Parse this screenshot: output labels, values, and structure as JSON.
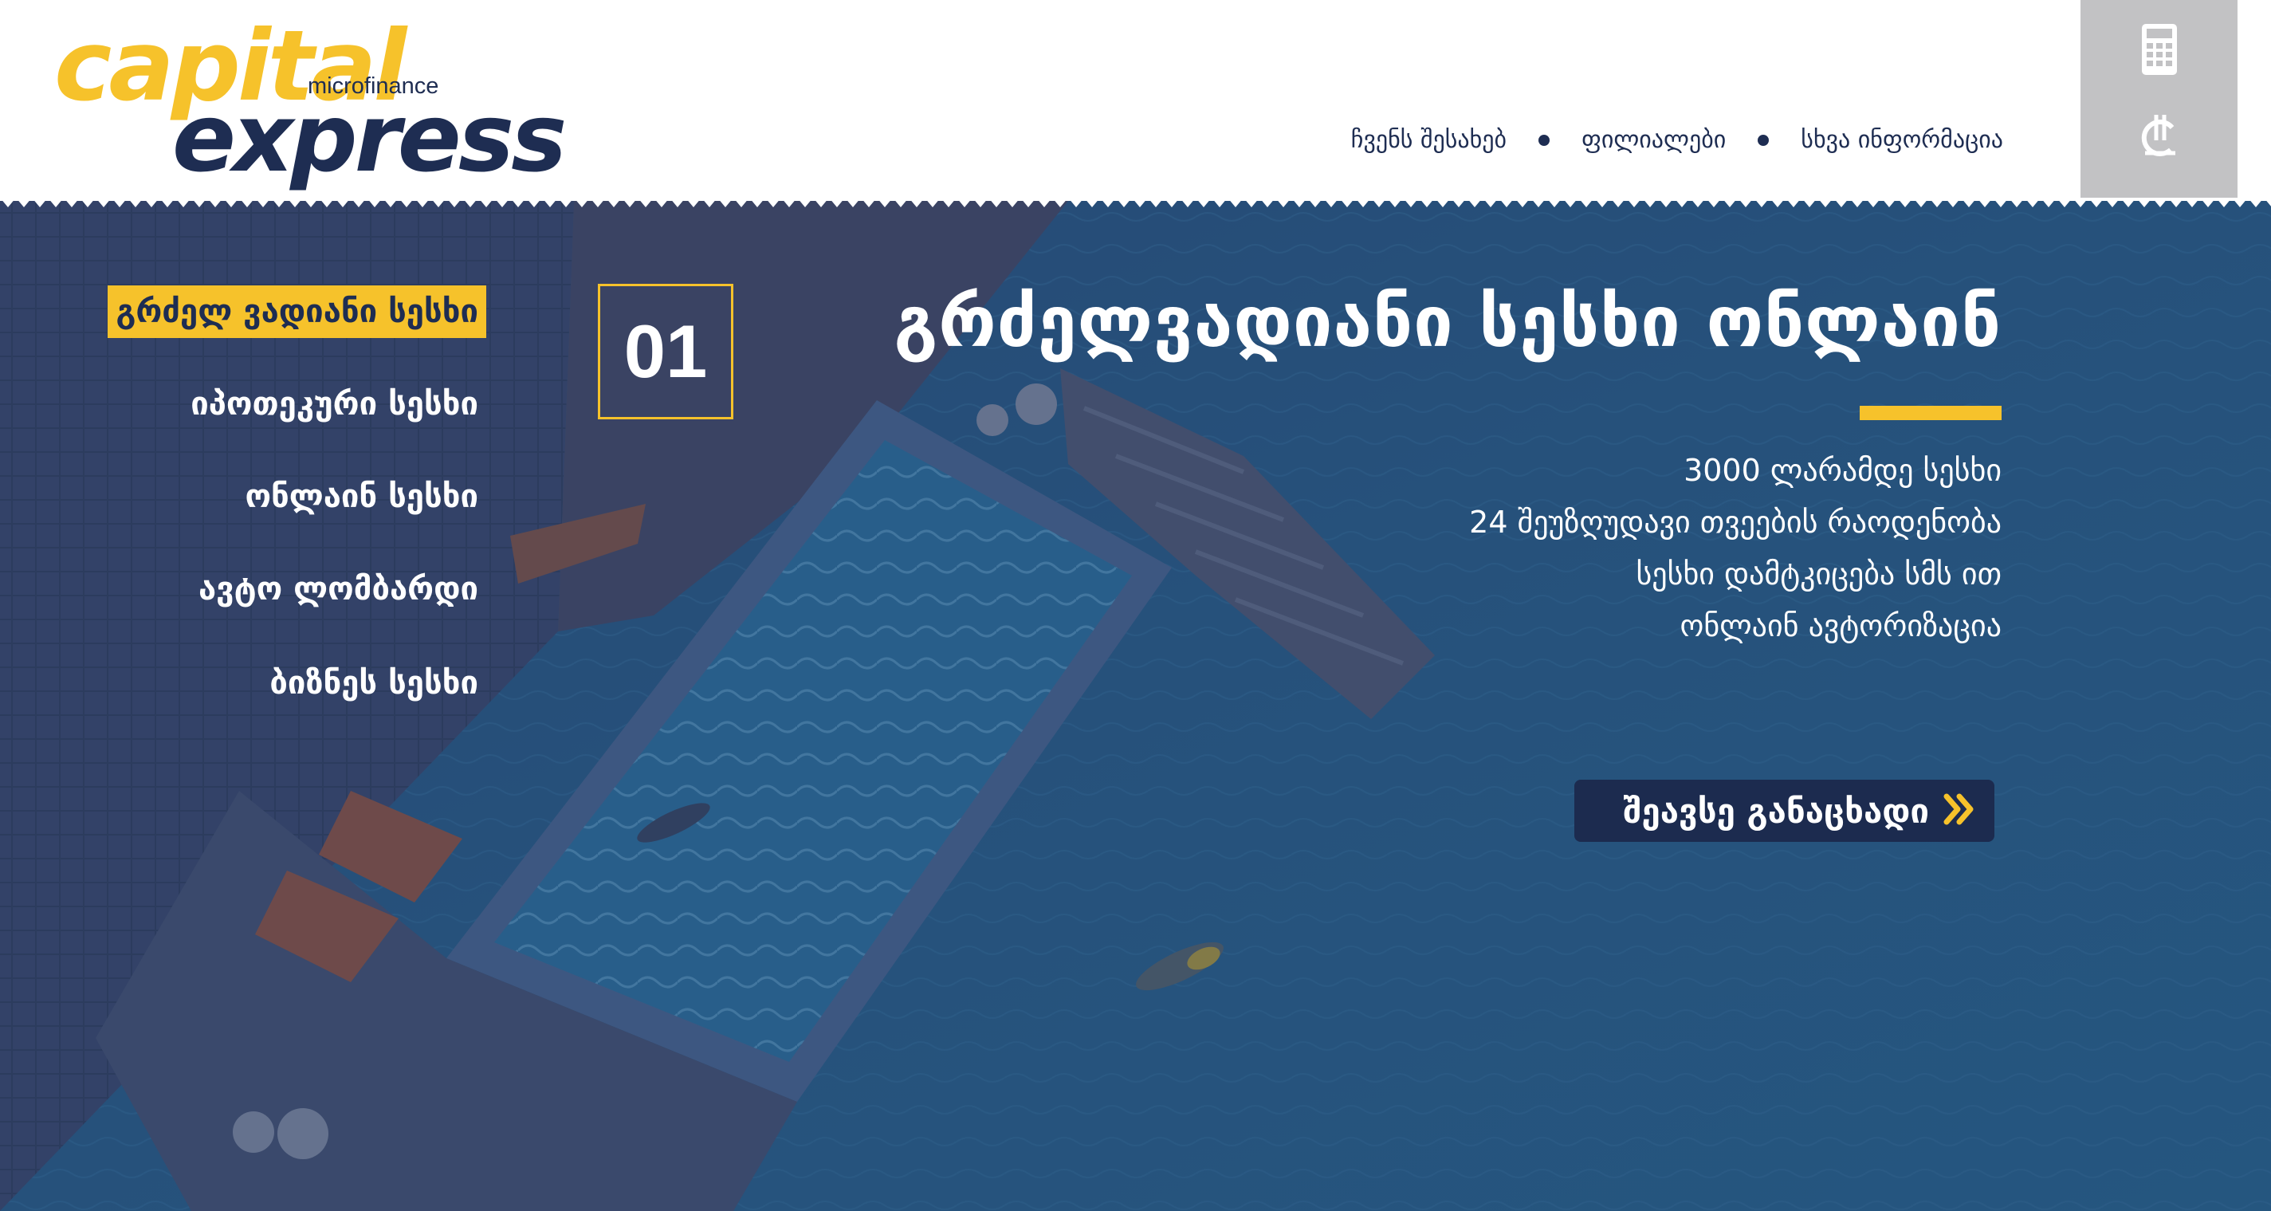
{
  "brand": {
    "logo_word1": "capital",
    "logo_word2": "express",
    "logo_tagline": "microfinance",
    "accent_color": "#f6c22b",
    "navy_color": "#1e2d52"
  },
  "topnav": {
    "items": [
      {
        "label": "ჩვენს შესახებ"
      },
      {
        "label": "ფილიალები"
      },
      {
        "label": "სხვა ინფორმაცია"
      }
    ]
  },
  "side_tools": {
    "calculator_icon": "calculator-icon",
    "currency_icon": "lari-currency-icon"
  },
  "side_menu": {
    "items": [
      {
        "label": "გრძელ ვადიანი სესხი",
        "active": true
      },
      {
        "label": "იპოთეკური სესხი",
        "active": false
      },
      {
        "label": "ონლაინ სესხი",
        "active": false
      },
      {
        "label": "ავტო ლომბარდი",
        "active": false
      },
      {
        "label": "ბიზნეს სესხი",
        "active": false
      }
    ]
  },
  "hero": {
    "slide_number": "01",
    "title": "გრძელვადიანი სესხი ონლაინ",
    "features": [
      "3000 ლარამდე სესხი",
      "24 შეუზღუდავი თვეების რაოდენობა",
      "სესხი დამტკიცება სმს ით",
      "ონლაინ ავტორიზაცია"
    ],
    "cta_label": "შეავსე განაცხადი",
    "cta_icon": "double-chevron-right-icon"
  }
}
